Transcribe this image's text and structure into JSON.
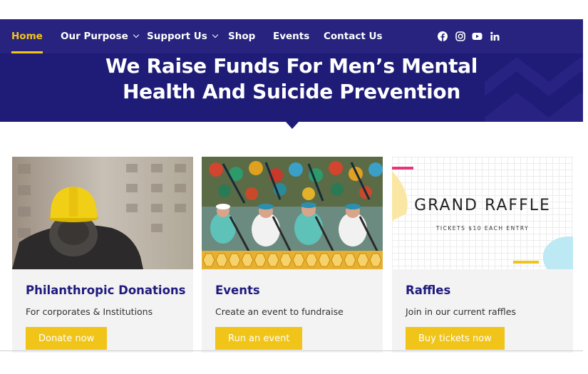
{
  "nav": {
    "items": [
      {
        "label": "Home",
        "active": true,
        "dropdown": false
      },
      {
        "label": "Our Purpose",
        "active": false,
        "dropdown": true
      },
      {
        "label": "Support Us",
        "active": false,
        "dropdown": true
      },
      {
        "label": "Shop",
        "active": false,
        "dropdown": false
      },
      {
        "label": "Events",
        "active": false,
        "dropdown": false
      },
      {
        "label": "Contact Us",
        "active": false,
        "dropdown": false
      }
    ],
    "social": [
      "facebook-icon",
      "instagram-icon",
      "youtube-icon",
      "linkedin-icon"
    ]
  },
  "hero": {
    "title_line1": "We Raise Funds For Men’s Mental",
    "title_line2": "Health And Suicide Prevention"
  },
  "cards": [
    {
      "title": "Philanthropic Donations",
      "description": "For corporates & Institutions",
      "button": "Donate now",
      "image": "worker-hard-hat-image"
    },
    {
      "title": "Events",
      "description": "Create an event to fundraise",
      "button": "Run an event",
      "image": "dragon-boat-race-image"
    },
    {
      "title": "Raffles",
      "description": "Join in our current raffles",
      "button": "Buy tickets now",
      "image": "grand-raffle-image",
      "image_text": {
        "title": "GRAND RAFFLE",
        "subtitle": "TICKETS $10 EACH ENTRY"
      }
    }
  ],
  "colors": {
    "brand": "#27237e",
    "accent": "#f0c419",
    "title": "#1e1a7d",
    "card_bg": "#f3f3f3"
  }
}
